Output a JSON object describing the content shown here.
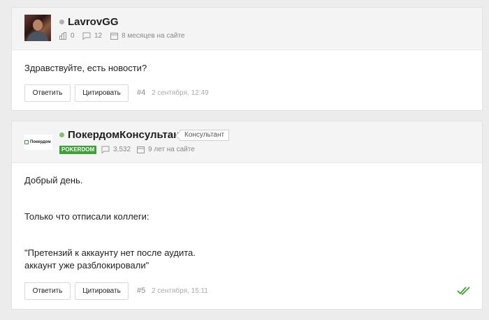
{
  "posts": [
    {
      "username": "LavrovGG",
      "status_color": "#b0b0b0",
      "stats": {
        "reactions": "0",
        "messages": "12",
        "on_site": "8 месяцев на сайте"
      },
      "body": [
        "Здравствуйте, есть новости?"
      ],
      "reply_label": "Ответить",
      "quote_label": "Цитировать",
      "post_number": "#4",
      "date": "2 сентября, 12:49"
    },
    {
      "username": "ПокердомКонсультант",
      "status_color": "#7cc36b",
      "avatar_logo_text": "Покердом",
      "role_badge": "Консультант",
      "brand_badge": "POKERDOM",
      "brand_color": "#3aa335",
      "stats": {
        "messages": "3,532",
        "on_site": "9 лет на сайте"
      },
      "body": [
        "Добрый день.",
        "Только что отписали коллеги:",
        "\"Претензий к аккаунту нет после аудита.",
        "аккаунт уже разблокировали\""
      ],
      "reply_label": "Ответить",
      "quote_label": "Цитировать",
      "post_number": "#5",
      "date": "2 сентября, 15:11",
      "read_check_color": "#3aa335"
    }
  ]
}
